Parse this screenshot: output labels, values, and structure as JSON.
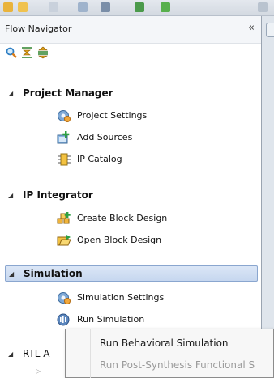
{
  "flow_navigator": {
    "title": "Flow Navigator",
    "collapse_label": "«",
    "tool_icons": [
      "search-icon",
      "collapse-all-icon",
      "expand-all-icon"
    ],
    "sections": [
      {
        "name": "project-manager",
        "label": "Project Manager",
        "items": [
          {
            "label": "Project Settings",
            "icon": "settings-gear-icon"
          },
          {
            "label": "Add Sources",
            "icon": "add-sources-icon"
          },
          {
            "label": "IP Catalog",
            "icon": "ip-catalog-icon"
          }
        ]
      },
      {
        "name": "ip-integrator",
        "label": "IP Integrator",
        "items": [
          {
            "label": "Create Block Design",
            "icon": "create-block-design-icon"
          },
          {
            "label": "Open Block Design",
            "icon": "open-block-design-icon"
          }
        ]
      },
      {
        "name": "simulation",
        "label": "Simulation",
        "selected": true,
        "items": [
          {
            "label": "Simulation Settings",
            "icon": "settings-gear-icon"
          },
          {
            "label": "Run Simulation",
            "icon": "run-simulation-icon"
          }
        ]
      },
      {
        "name": "rtl-analysis",
        "label": "RTL A",
        "items": []
      }
    ]
  },
  "context_menu": {
    "items": [
      {
        "label": "Run Behavioral Simulation",
        "enabled": true
      },
      {
        "label": "Run Post-Synthesis Functional S",
        "enabled": false
      }
    ]
  },
  "colors": {
    "selection_fill": "#c6d7ef",
    "selection_border": "#8aa6cf",
    "disabled_text": "#9a9a9a"
  }
}
